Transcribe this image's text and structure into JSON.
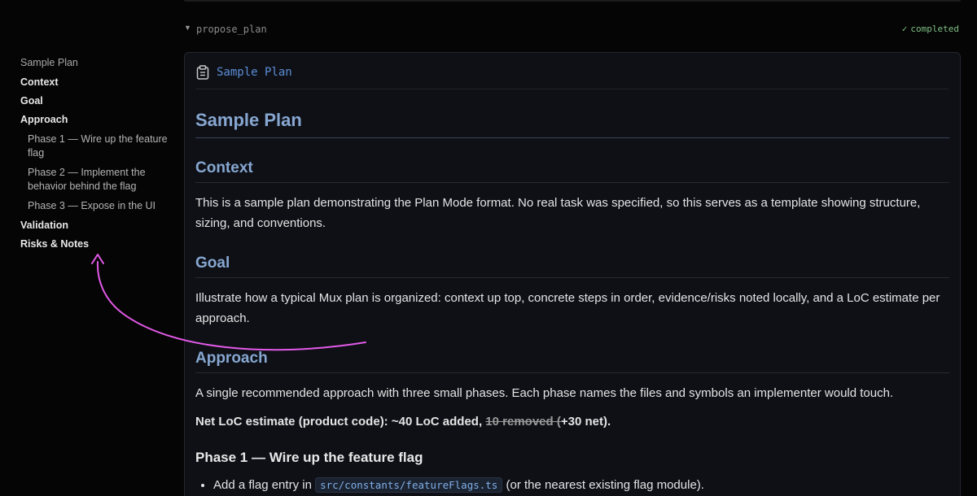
{
  "tool": {
    "name": "propose_plan",
    "status": "completed"
  },
  "toc": {
    "title": "Sample Plan",
    "items": [
      {
        "label": "Context"
      },
      {
        "label": "Goal"
      },
      {
        "label": "Approach"
      },
      {
        "label": "Phase 1 — Wire up the feature flag",
        "sub": true
      },
      {
        "label": "Phase 2 — Implement the behavior behind the flag",
        "sub": true
      },
      {
        "label": "Phase 3 — Expose in the UI",
        "sub": true
      },
      {
        "label": "Validation"
      },
      {
        "label": "Risks & Notes"
      }
    ]
  },
  "card": {
    "title": "Sample Plan",
    "h1": "Sample Plan",
    "context_heading": "Context",
    "context_text": "This is a sample plan demonstrating the Plan Mode format. No real task was specified, so this serves as a template showing structure, sizing, and conventions.",
    "goal_heading": "Goal",
    "goal_text": "Illustrate how a typical Mux plan is organized: context up top, concrete steps in order, evidence/risks noted locally, and a LoC estimate per approach.",
    "approach_heading": "Approach",
    "approach_text": "A single recommended approach with three small phases. Each phase names the files and symbols an implementer would touch.",
    "loc_prefix": "Net LoC estimate (product code): ~40 LoC added, ",
    "loc_struck": "10 removed (",
    "loc_suffix": "+30 net).",
    "phase1_heading": "Phase 1 — Wire up the feature flag",
    "phase1_bullet_prefix": "Add a flag entry in ",
    "phase1_bullet_code": "src/constants/featureFlags.ts",
    "phase1_bullet_suffix": " (or the nearest existing flag module)."
  },
  "colors": {
    "accent": "#5c8ed6",
    "heading": "#87a7d1",
    "status": "#7dbf82",
    "annotation": "#e35ae8"
  }
}
